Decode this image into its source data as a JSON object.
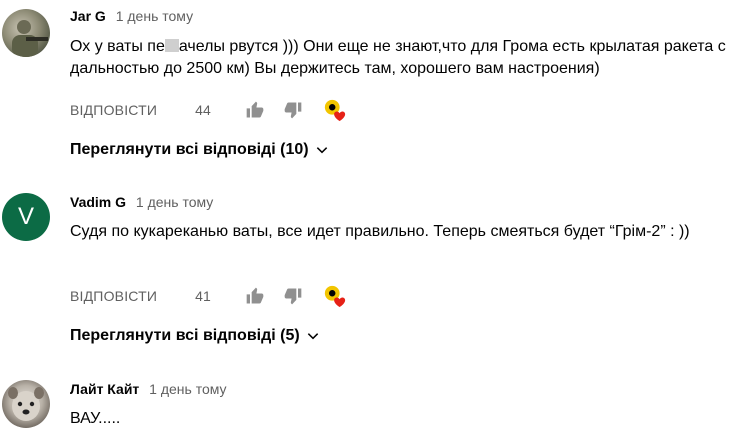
{
  "comments": [
    {
      "author": "Jar G",
      "time": "1 день тому",
      "text_before": "Ох у ваты пе",
      "text_after": "ачелы рвутся ))) Они еще не знают,что для Грома есть крылатая ракета с дальностью до 2500 км) Вы держитесь там, хорошего вам настроения)",
      "reply_label": "ВІДПОВІСТИ",
      "likes": "44",
      "view_replies": "Переглянути всі відповіді (10)"
    },
    {
      "author": "Vadim G",
      "avatar_letter": "V",
      "time": "1 день тому",
      "text": "Судя по кукареканью ваты, все идет правильно. Теперь смеяться будет  “Грім-2” : ))",
      "reply_label": "ВІДПОВІСТИ",
      "likes": "41",
      "view_replies": "Переглянути всі відповіді (5)"
    },
    {
      "author": "Лайт Кайт",
      "time": "1 день тому",
      "text": "ВАУ....."
    }
  ],
  "colors": {
    "text": "#030303",
    "secondary": "#606060",
    "avatar_v": "#0c6b45",
    "heart": "#e62117",
    "creator_badge": "#f2c500"
  }
}
